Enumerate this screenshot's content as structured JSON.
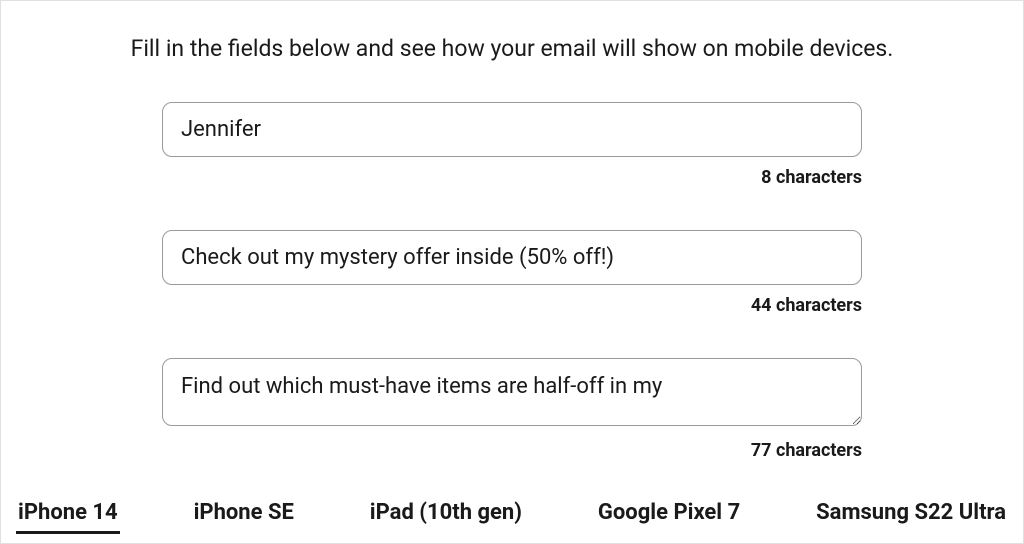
{
  "instruction": "Fill in the fields below and see how your email will show on mobile devices.",
  "fields": {
    "sender": {
      "value": "Jennifer",
      "char_count": "8 characters"
    },
    "subject": {
      "value": "Check out my mystery offer inside (50% off!)",
      "char_count": "44 characters"
    },
    "preheader": {
      "value": "Find out which must-have items are half-off in my",
      "char_count": "77 characters"
    }
  },
  "tabs": [
    {
      "label": "iPhone 14",
      "active": true
    },
    {
      "label": "iPhone SE",
      "active": false
    },
    {
      "label": "iPad (10th gen)",
      "active": false
    },
    {
      "label": "Google Pixel 7",
      "active": false
    },
    {
      "label": "Samsung S22 Ultra",
      "active": false
    }
  ]
}
